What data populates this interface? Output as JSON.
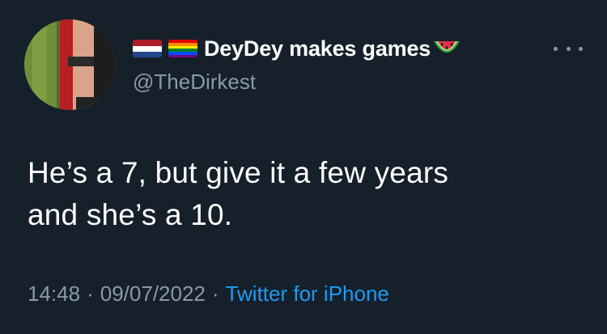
{
  "user": {
    "display_name": "DeyDey makes games",
    "handle": "@TheDirkest",
    "flags": [
      "netherlands-flag",
      "rainbow-pride-flag"
    ],
    "trailing_emoji": "watermelon"
  },
  "tweet": {
    "text_line1": "He’s a 7, but give it a few years",
    "text_line2": "and she’s a 10.",
    "time": "14:48",
    "date": "09/07/2022",
    "separator": "·",
    "source": "Twitter for iPhone"
  },
  "colors": {
    "background": "#15202b",
    "text": "#ffffff",
    "secondary": "#8b98a5",
    "link": "#1d9bf0"
  }
}
